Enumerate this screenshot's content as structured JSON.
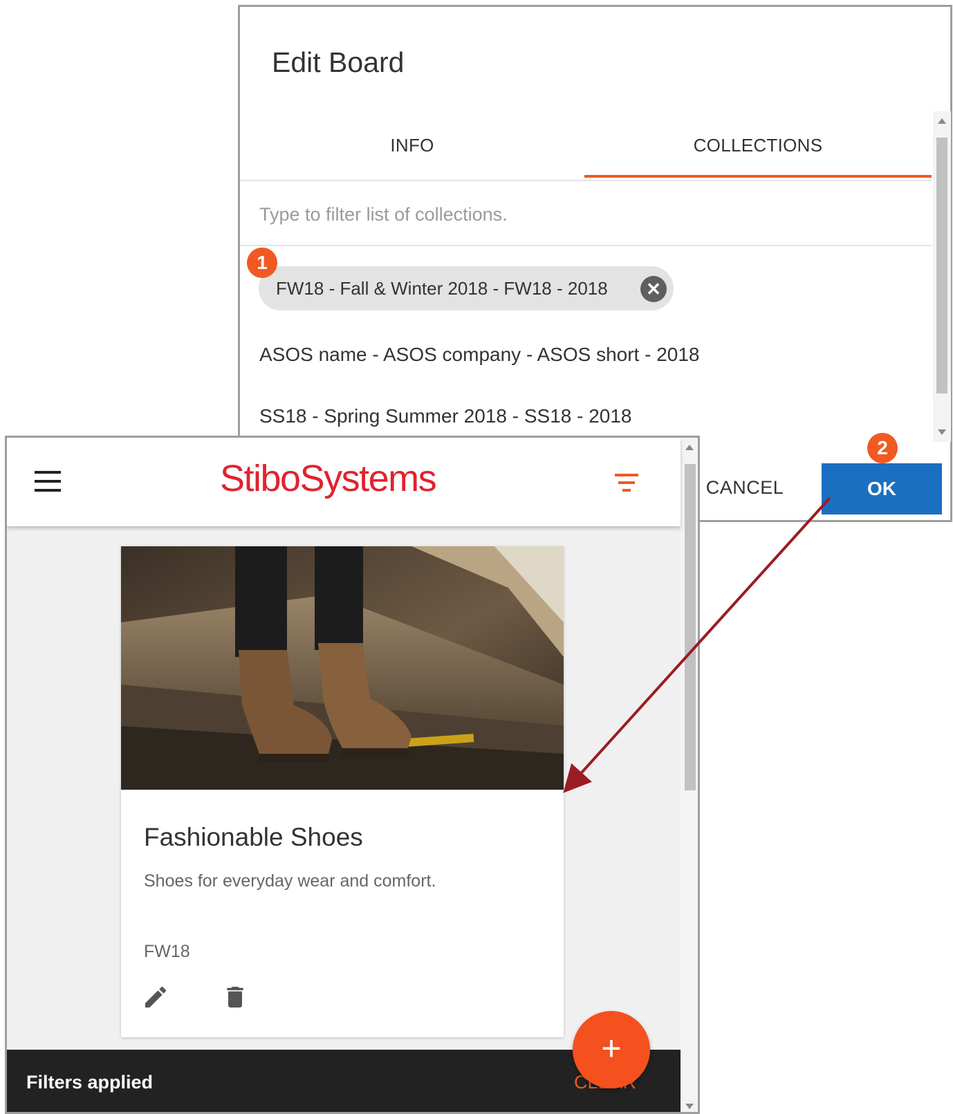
{
  "dialog": {
    "title": "Edit Board",
    "tabs": [
      {
        "label": "INFO",
        "selected": false
      },
      {
        "label": "COLLECTIONS",
        "selected": true
      }
    ],
    "filter_placeholder": "Type to filter list of collections.",
    "selected_chip": "FW18 - Fall & Winter 2018 - FW18 - 2018",
    "collections": [
      "ASOS name - ASOS company - ASOS short - 2018",
      "SS18 - Spring Summer 2018 - SS18 - 2018"
    ],
    "cancel_label": "CANCEL",
    "ok_label": "OK",
    "accent_color": "#f05a22",
    "primary_color": "#1a6fc0"
  },
  "callouts": {
    "badge_1": "1",
    "badge_2": "2"
  },
  "app": {
    "logo": "StiboSystems",
    "card": {
      "title": "Fashionable Shoes",
      "description": "Shoes for everyday wear and comfort.",
      "collection": "FW18"
    },
    "snackbar": {
      "text": "Filters applied",
      "action": "CLEAR"
    },
    "fab_symbol": "+"
  }
}
